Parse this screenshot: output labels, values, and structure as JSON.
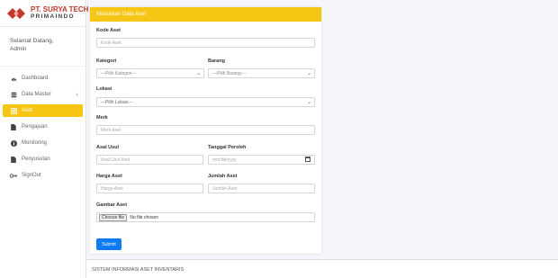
{
  "brand": {
    "name_line1": "PT. SURYA TECH",
    "name_line2": "PRIMAINDO"
  },
  "user": {
    "greeting": "Selamat Datang,",
    "role": "Admin"
  },
  "sidebar": {
    "items": [
      {
        "label": "Dashboard",
        "icon": "dashboard-icon"
      },
      {
        "label": "Data Master",
        "icon": "database-icon",
        "caret": "‹"
      },
      {
        "label": "Aset",
        "icon": "table-icon"
      },
      {
        "label": "Pengajuan",
        "icon": "file-icon"
      },
      {
        "label": "Monitoring",
        "icon": "info-icon"
      },
      {
        "label": "Penyusutan",
        "icon": "file-icon"
      },
      {
        "label": "SignOut",
        "icon": "signout-icon"
      }
    ]
  },
  "form": {
    "header": "Masukkan Data Aset",
    "kode_aset": {
      "label": "Kode Aset",
      "placeholder": "Kode Aset"
    },
    "kategori": {
      "label": "Kategori",
      "selected": "---Pilih Kategori---"
    },
    "barang": {
      "label": "Barang",
      "selected": "---Pilih Barang---"
    },
    "lokasi": {
      "label": "Lokasi",
      "selected": "---Pilih Lokasi---"
    },
    "merk": {
      "label": "Merk",
      "placeholder": "Merk Aset"
    },
    "asal_usul": {
      "label": "Asal Usul",
      "placeholder": "Asal Usul Aset"
    },
    "tanggal_peroleh": {
      "label": "Tanggal Peroleh",
      "placeholder": "mm/dd/yyyy"
    },
    "harga_aset": {
      "label": "Harga Aset",
      "placeholder": "Harga Aset"
    },
    "jumlah_aset": {
      "label": "Jumlah Aset",
      "placeholder": "Jumlah Aset"
    },
    "gambar_aset": {
      "label": "Gambar Aset",
      "button": "Choose file",
      "status": "No file chosen"
    },
    "submit": "Submit"
  },
  "footer": {
    "text": "SISTEM INFORMASI ASET INVENTARIS"
  },
  "colors": {
    "accent": "#f7c614",
    "primary_button": "#0d7cf2",
    "brand_red": "#c0392b"
  }
}
